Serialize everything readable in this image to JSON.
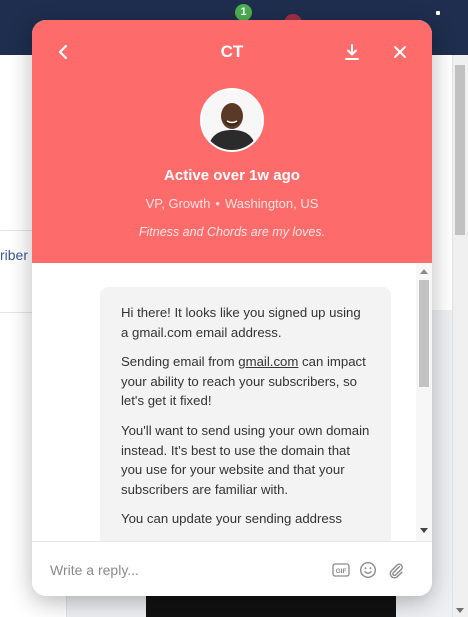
{
  "background": {
    "notification_count": "1",
    "tab_text": "riber"
  },
  "messenger": {
    "header": {
      "title": "CT",
      "status": "Active over 1w ago",
      "role": "VP, Growth",
      "location": "Washington, US",
      "bio": "Fitness and Chords are my loves.",
      "back_icon": "chevron-left-icon",
      "download_icon": "download-icon",
      "close_icon": "close-icon",
      "color": "#fe6b6b"
    },
    "message": {
      "p1": "Hi there! It looks like you signed up using a gmail.com email address.",
      "p2_before": "Sending email from ",
      "p2_link": "gmail.com",
      "p2_after": " can impact your ability to reach your subscribers, so let's get it fixed!",
      "p3": "You'll want to send using your own domain instead. It's best to use the domain that you use for your website and that your subscribers are familiar with.",
      "p4": "You can update your sending address"
    },
    "composer": {
      "placeholder": "Write a reply...",
      "gif_label": "GIF",
      "emoji_icon": "smiley-icon",
      "attach_icon": "paperclip-icon"
    }
  }
}
